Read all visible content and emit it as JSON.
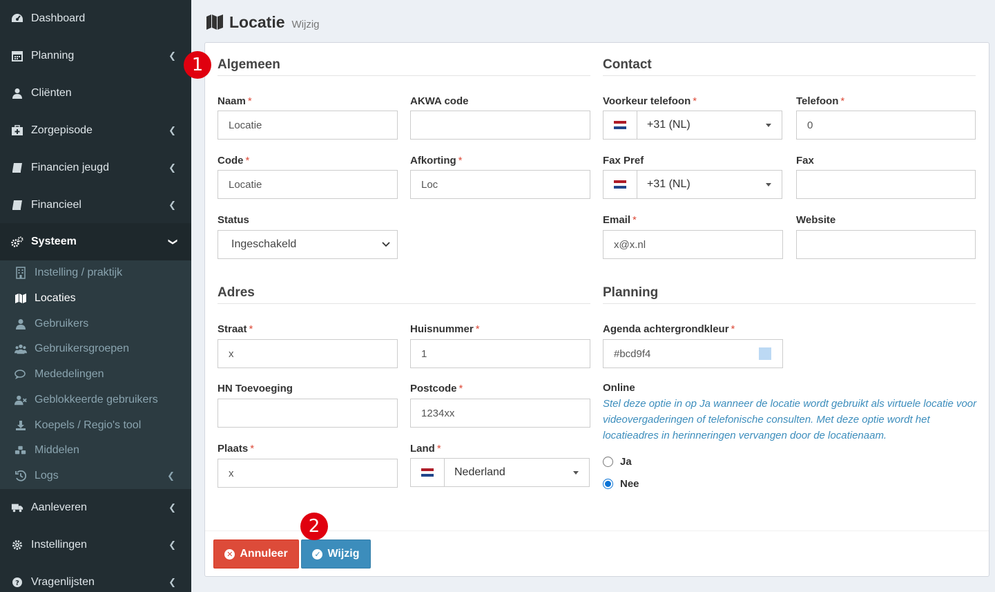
{
  "sidebar": {
    "items": [
      {
        "label": "Dashboard",
        "icon": "dashboard-icon"
      },
      {
        "label": "Planning",
        "icon": "calendar-icon"
      },
      {
        "label": "Cliënten",
        "icon": "user-icon"
      },
      {
        "label": "Zorgepisode",
        "icon": "medkit-icon"
      },
      {
        "label": "Financien jeugd",
        "icon": "book-icon"
      },
      {
        "label": "Financieel",
        "icon": "book-icon"
      },
      {
        "label": "Systeem",
        "icon": "cogs-icon"
      },
      {
        "label": "Aanleveren",
        "icon": "truck-icon"
      },
      {
        "label": "Instellingen",
        "icon": "gear-icon"
      },
      {
        "label": "Vragenlijsten",
        "icon": "question-icon"
      }
    ],
    "submenu": [
      {
        "label": "Instelling / praktijk",
        "icon": "building-icon"
      },
      {
        "label": "Locaties",
        "icon": "map-icon"
      },
      {
        "label": "Gebruikers",
        "icon": "user-icon"
      },
      {
        "label": "Gebruikersgroepen",
        "icon": "users-icon"
      },
      {
        "label": "Mededelingen",
        "icon": "comments-icon"
      },
      {
        "label": "Geblokkeerde gebruikers",
        "icon": "user-times-icon"
      },
      {
        "label": "Koepels / Regio's tool",
        "icon": "download-icon"
      },
      {
        "label": "Middelen",
        "icon": "cubes-icon"
      },
      {
        "label": "Logs",
        "icon": "history-icon"
      }
    ]
  },
  "header": {
    "title": "Locatie",
    "subtitle": "Wijzig"
  },
  "sections": {
    "algemeen": "Algemeen",
    "contact": "Contact",
    "adres": "Adres",
    "planning": "Planning"
  },
  "fields": {
    "naam": {
      "label": "Naam",
      "value": "Locatie"
    },
    "akwa": {
      "label": "AKWA code",
      "value": ""
    },
    "code": {
      "label": "Code",
      "value": "Locatie"
    },
    "afkorting": {
      "label": "Afkorting",
      "value": "Loc"
    },
    "status": {
      "label": "Status",
      "value": "Ingeschakeld"
    },
    "voorkeur_telefoon": {
      "label": "Voorkeur telefoon",
      "value": "+31 (NL)"
    },
    "telefoon": {
      "label": "Telefoon",
      "value": "0"
    },
    "fax_pref": {
      "label": "Fax Pref",
      "value": "+31 (NL)"
    },
    "fax": {
      "label": "Fax",
      "value": ""
    },
    "email": {
      "label": "Email",
      "value": "x@x.nl"
    },
    "website": {
      "label": "Website",
      "value": ""
    },
    "straat": {
      "label": "Straat",
      "value": "x"
    },
    "huisnummer": {
      "label": "Huisnummer",
      "value": "1"
    },
    "hn_toevoeging": {
      "label": "HN Toevoeging",
      "value": ""
    },
    "postcode": {
      "label": "Postcode",
      "value": "1234xx"
    },
    "plaats": {
      "label": "Plaats",
      "value": "x"
    },
    "land": {
      "label": "Land",
      "value": "Nederland"
    },
    "agenda_kleur": {
      "label": "Agenda achtergrondkleur",
      "value": "#bcd9f4"
    },
    "online": {
      "label": "Online",
      "help": "Stel deze optie in op Ja wanneer de locatie wordt gebruikt als virtuele locatie voor videovergaderingen of telefonische consulten. Met deze optie wordt het locatieadres in herinneringen vervangen door de locatienaam.",
      "options": [
        "Ja",
        "Nee"
      ],
      "selected": "Nee"
    }
  },
  "required_mark": "*",
  "buttons": {
    "cancel": "Annuleer",
    "save": "Wijzig"
  },
  "annotations": {
    "one": "1",
    "two": "2"
  },
  "colors": {
    "sidebar": "#222d32",
    "danger": "#dd4b39",
    "primary": "#3c8dbc",
    "swatch": "#bcd9f4"
  }
}
